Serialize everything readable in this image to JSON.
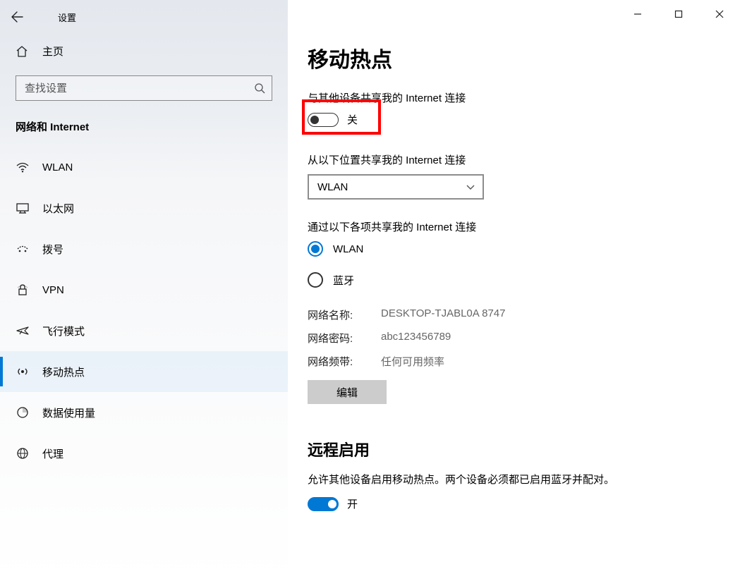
{
  "titlebar": {
    "app_title": "设置"
  },
  "sidebar": {
    "home_label": "主页",
    "search_placeholder": "查找设置",
    "category_header": "网络和 Internet",
    "items": [
      {
        "label": "WLAN"
      },
      {
        "label": "以太网"
      },
      {
        "label": "拨号"
      },
      {
        "label": "VPN"
      },
      {
        "label": "飞行模式"
      },
      {
        "label": "移动热点"
      },
      {
        "label": "数据使用量"
      },
      {
        "label": "代理"
      }
    ]
  },
  "main": {
    "page_title": "移动热点",
    "share_label": "与其他设备共享我的 Internet 连接",
    "share_toggle_state": "关",
    "share_from_label": "从以下位置共享我的 Internet 连接",
    "share_from_value": "WLAN",
    "share_over_label": "通过以下各项共享我的 Internet 连接",
    "radio_wlan": "WLAN",
    "radio_bt": "蓝牙",
    "info": {
      "name_key": "网络名称:",
      "name_val": "DESKTOP-TJABL0A 8747",
      "pwd_key": "网络密码:",
      "pwd_val": "abc123456789",
      "band_key": "网络频带:",
      "band_val": "任何可用频率"
    },
    "edit_label": "编辑",
    "remote_heading": "远程启用",
    "remote_desc": "允许其他设备启用移动热点。两个设备必须都已启用蓝牙并配对。",
    "remote_toggle_state": "开"
  }
}
